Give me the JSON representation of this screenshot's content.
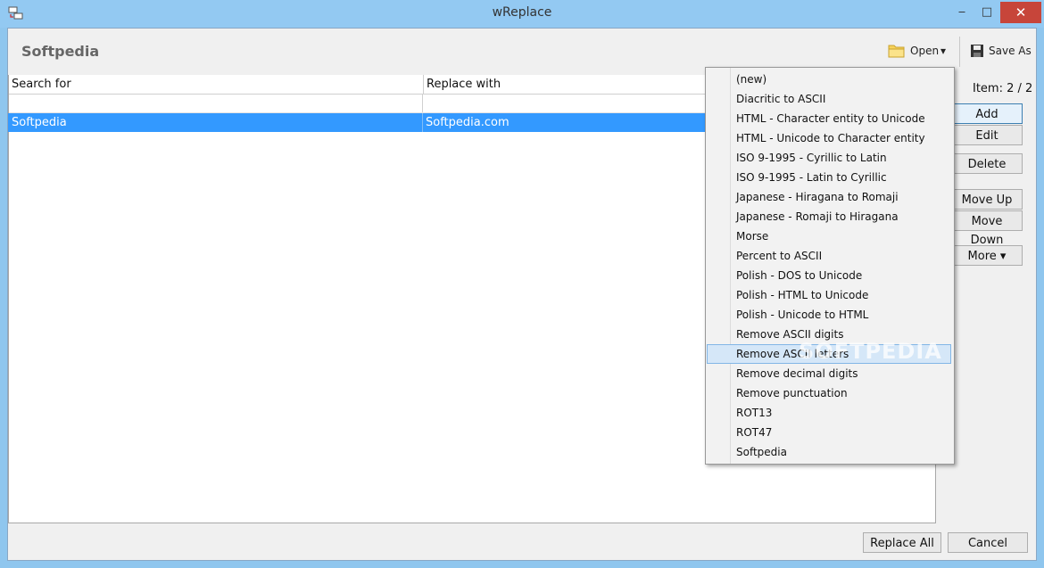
{
  "window": {
    "title": "wReplace",
    "minimize_glyph": "‒",
    "maximize_glyph": "□",
    "close_glyph": "✕"
  },
  "header": {
    "title": "Softpedia",
    "open_label": "Open",
    "open_dropdown_glyph": "▾",
    "save_as_label": "Save As"
  },
  "grid": {
    "columns": [
      "Search for",
      "Replace with"
    ],
    "rows": [
      {
        "search": "",
        "replace": ""
      },
      {
        "search": "Softpedia",
        "replace": "Softpedia.com"
      }
    ],
    "selected_row": 1
  },
  "side_panel": {
    "item_count": "Item: 2 / 2",
    "add_label": "Add",
    "edit_label": "Edit",
    "delete_label": "Delete",
    "move_up_label": "Move Up",
    "move_down_label": "Move Down",
    "more_label": "More ▾"
  },
  "footer": {
    "replace_all_label": "Replace All",
    "cancel_label": "Cancel"
  },
  "open_menu": {
    "items": [
      "(new)",
      "Diacritic to ASCII",
      "HTML - Character entity to Unicode",
      "HTML - Unicode to Character entity",
      "ISO 9-1995 - Cyrillic to Latin",
      "ISO 9-1995 - Latin to Cyrillic",
      "Japanese - Hiragana to Romaji",
      "Japanese - Romaji to Hiragana",
      "Morse",
      "Percent to ASCII",
      "Polish - DOS to Unicode",
      "Polish - HTML to Unicode",
      "Polish - Unicode to HTML",
      "Remove ASCII digits",
      "Remove ASCII letters",
      "Remove decimal digits",
      "Remove punctuation",
      "ROT13",
      "ROT47",
      "Softpedia"
    ],
    "highlighted_index": 14
  },
  "watermark": "SOFTPEDIA",
  "colors": {
    "titlebar": "#93c9f2",
    "selection": "#3399ff",
    "close_button": "#c7453a",
    "menu_highlight": "#d5e7f8"
  }
}
